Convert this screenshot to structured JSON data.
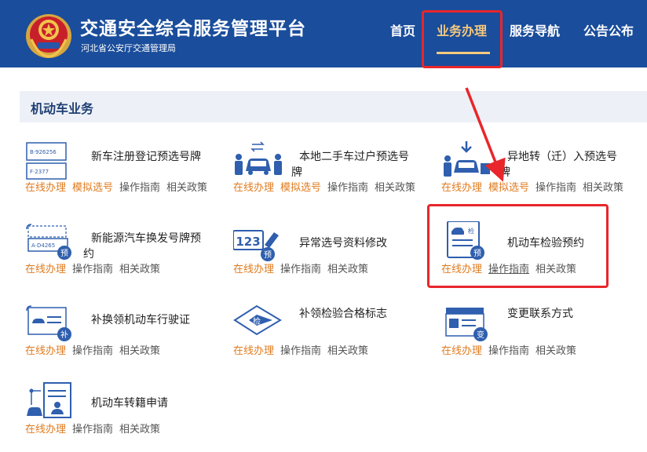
{
  "header": {
    "title": "交通安全综合服务管理平台",
    "subtitle": "河北省公安厅交通管理局",
    "nav": [
      "首页",
      "业务办理",
      "服务导航",
      "公告公布"
    ],
    "active_nav": "业务办理"
  },
  "section": {
    "title": "机动车业务"
  },
  "cards": [
    {
      "name": "新车注册登记预选号牌",
      "links": [
        "在线办理",
        "模拟选号",
        "操作指南",
        "相关政策"
      ],
      "icon": "plate-icon"
    },
    {
      "name": "本地二手车过户预选号牌",
      "links": [
        "在线办理",
        "模拟选号",
        "操作指南",
        "相关政策"
      ],
      "icon": "transfer-car-icon"
    },
    {
      "name": "异地转（迁）入预选号牌",
      "links": [
        "在线办理",
        "模拟选号",
        "操作指南",
        "相关政策"
      ],
      "icon": "move-in-car-icon"
    },
    {
      "name": "新能源汽车换发号牌预约",
      "links": [
        "在线办理",
        "操作指南",
        "相关政策"
      ],
      "icon": "new-energy-plate-icon",
      "badge": "预"
    },
    {
      "name": "异常选号资料修改",
      "links": [
        "在线办理",
        "操作指南",
        "相关政策"
      ],
      "icon": "number-edit-icon",
      "badge": "预"
    },
    {
      "name": "机动车检验预约",
      "links": [
        "在线办理",
        "操作指南",
        "相关政策"
      ],
      "icon": "inspection-doc-icon",
      "badge": "预"
    },
    {
      "name": "补换领机动车行驶证",
      "links": [
        "在线办理",
        "操作指南",
        "相关政策"
      ],
      "icon": "license-icon",
      "badge": "补"
    },
    {
      "name": "补领检验合格标志",
      "links": [
        "在线办理",
        "操作指南",
        "相关政策"
      ],
      "icon": "inspection-mark-icon"
    },
    {
      "name": "变更联系方式",
      "links": [
        "在线办理",
        "操作指南",
        "相关政策"
      ],
      "icon": "contact-change-icon",
      "badge": "变"
    },
    {
      "name": "机动车转籍申请",
      "links": [
        "在线办理",
        "操作指南",
        "相关政策"
      ],
      "icon": "transfer-registration-icon"
    }
  ],
  "icon_texts": {
    "plate_top": "B·926256",
    "plate_bottom": "F·2377",
    "new_plate": "A·D4265",
    "numbers": "123",
    "jian": "检"
  },
  "colors": {
    "header_bg": "#1a4d9b",
    "accent_gold": "#f5c97d",
    "link_orange": "#e07b1f",
    "highlight_red": "#e8262b",
    "icon_blue": "#2f5fae"
  }
}
